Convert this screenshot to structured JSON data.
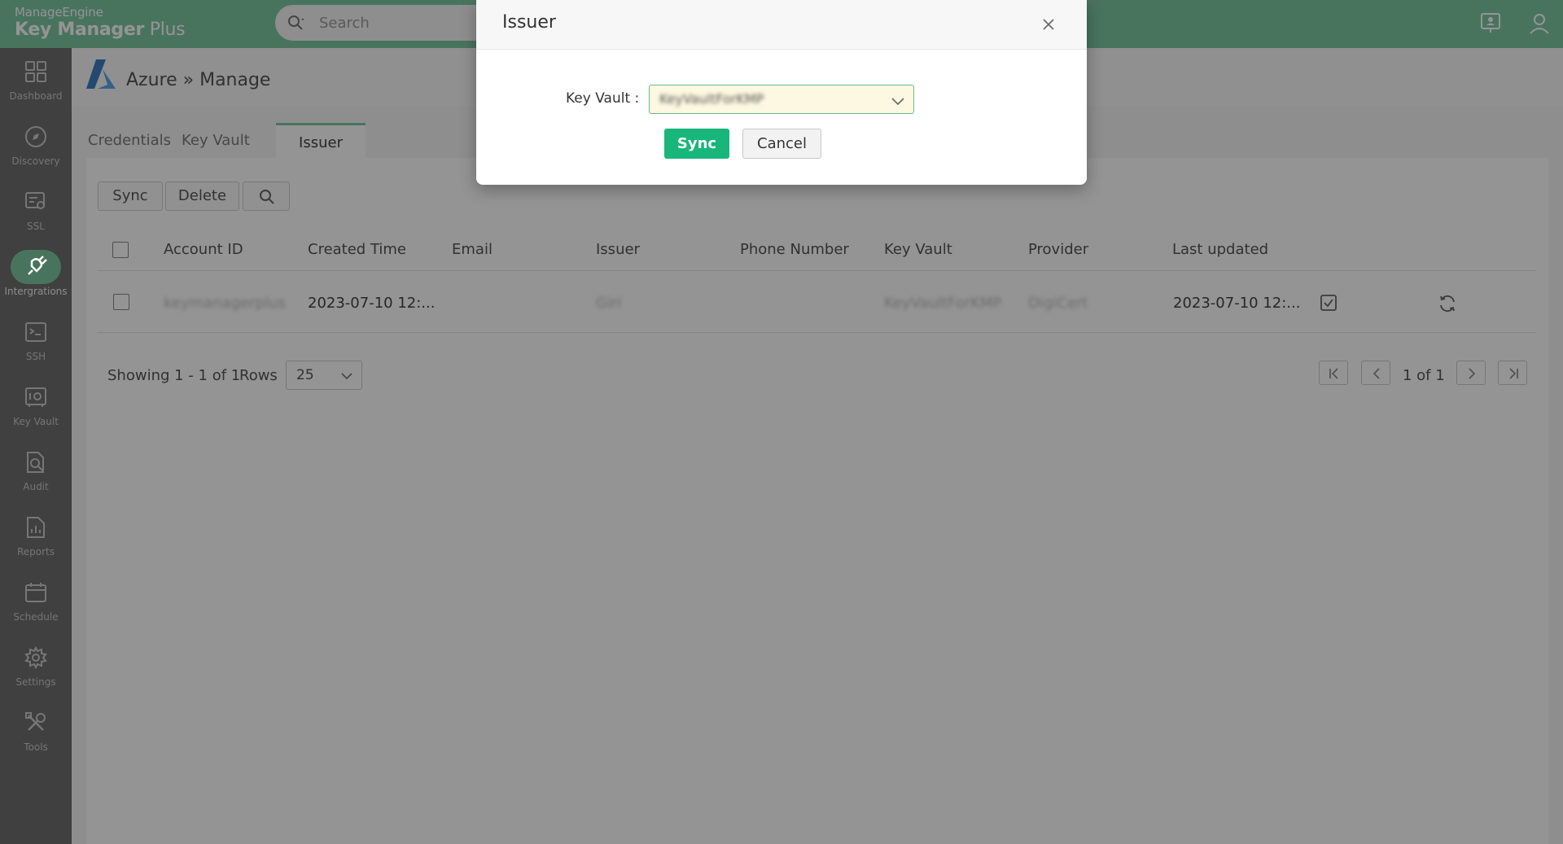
{
  "brand": {
    "vendor": "ManageEngine",
    "product_bold": "Key Manager",
    "product_light": " Plus"
  },
  "search": {
    "placeholder": "Search"
  },
  "sidebar": {
    "items": [
      {
        "label": "Dashboard",
        "icon": "dashboard-icon"
      },
      {
        "label": "Discovery",
        "icon": "compass-icon"
      },
      {
        "label": "SSL",
        "icon": "certificate-icon"
      },
      {
        "label": "Intergrations",
        "icon": "plug-icon",
        "active": true
      },
      {
        "label": "SSH",
        "icon": "terminal-icon"
      },
      {
        "label": "Key Vault",
        "icon": "vault-icon"
      },
      {
        "label": "Audit",
        "icon": "audit-search-icon"
      },
      {
        "label": "Reports",
        "icon": "report-chart-icon"
      },
      {
        "label": "Schedule",
        "icon": "calendar-icon"
      },
      {
        "label": "Settings",
        "icon": "gear-icon"
      },
      {
        "label": "Tools",
        "icon": "tools-icon"
      }
    ]
  },
  "page": {
    "title": "Azure » Manage"
  },
  "tabs": [
    {
      "label": "Credentials"
    },
    {
      "label": "Key Vault"
    },
    {
      "label": "Issuer",
      "active": true
    }
  ],
  "toolbar": {
    "sync_label": "Sync",
    "delete_label": "Delete"
  },
  "table": {
    "columns": [
      "Account ID",
      "Created Time",
      "Email",
      "Issuer",
      "Phone Number",
      "Key Vault",
      "Provider",
      "Last updated"
    ],
    "rows": [
      {
        "account_id": "keymanagerplus",
        "created_time": "2023-07-10 12:...",
        "email": "",
        "issuer": "Giri",
        "phone": "",
        "key_vault": "KeyVaultForKMP",
        "provider": "DigiCert",
        "last_updated": "2023-07-10 12:..."
      }
    ]
  },
  "pagination": {
    "showing": "Showing 1 - 1 of 1",
    "rows_label": "Rows",
    "rows_value": "25",
    "page_info": "1 of 1"
  },
  "modal": {
    "title": "Issuer",
    "key_vault_label": "Key Vault :",
    "key_vault_value": "KeyVaultForKMP",
    "sync_label": "Sync",
    "cancel_label": "Cancel"
  },
  "colors": {
    "accent": "#7dc9a3",
    "primary_button": "#18b67a",
    "select_bg": "#fdf8e1"
  }
}
